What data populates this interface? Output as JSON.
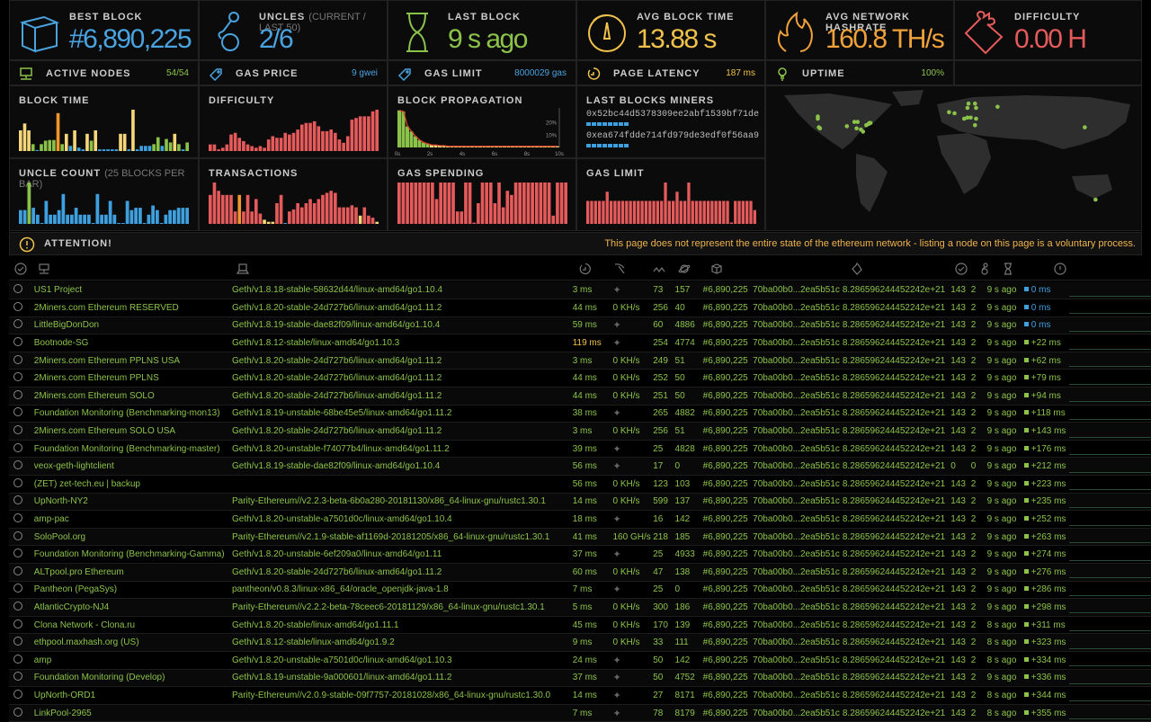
{
  "stats": {
    "best_block": {
      "label": "BEST BLOCK",
      "value": "#6,890,225",
      "color": "#4aa3df",
      "icon": "cube-icon"
    },
    "uncles": {
      "label": "UNCLES",
      "sublabel": "(CURRENT / LAST 50)",
      "value": "2/6",
      "color": "#4aa3df",
      "icon": "uncles-icon"
    },
    "last_block": {
      "label": "LAST BLOCK",
      "value": "9 s ago",
      "color": "#8bc34a",
      "icon": "hourglass-icon"
    },
    "avg_block_time": {
      "label": "AVG BLOCK TIME",
      "value": "13.88 s",
      "color": "#f0c24c",
      "icon": "gauge-icon"
    },
    "hashrate": {
      "label": "AVG NETWORK HASHRATE",
      "value": "160.8 TH/s",
      "color": "#f0a13a",
      "icon": "flame-icon"
    },
    "difficulty": {
      "label": "DIFFICULTY",
      "value": "0.00 H",
      "color": "#e55a5a",
      "icon": "puzzle-icon"
    }
  },
  "small_stats": {
    "active_nodes": {
      "label": "ACTIVE NODES",
      "value": "54/54",
      "color": "#8bc34a"
    },
    "gas_price": {
      "label": "GAS PRICE",
      "value": "9 gwei",
      "color": "#4aa3df"
    },
    "gas_limit": {
      "label": "GAS LIMIT",
      "value": "8000029 gas",
      "color": "#4aa3df"
    },
    "page_latency": {
      "label": "PAGE LATENCY",
      "value": "187 ms",
      "color": "#f0c24c"
    },
    "uptime": {
      "label": "UPTIME",
      "value": "100%",
      "color": "#8bc34a"
    }
  },
  "charts": {
    "block_time": {
      "title": "BLOCK TIME",
      "values": [
        6,
        8,
        6,
        2,
        0.3,
        2,
        3,
        3.2,
        3.2,
        11,
        2,
        5,
        1.5,
        6,
        1,
        0.5,
        5,
        3,
        6,
        0.5,
        0.5,
        0.5,
        0.5,
        0.5,
        5,
        5,
        0.5,
        12,
        0.5,
        1.5,
        1.5,
        1.5,
        2,
        4,
        1.5,
        3.5,
        2.5,
        5,
        2,
        0.5,
        2.5
      ],
      "colors": [
        "y",
        "y",
        "y",
        "g",
        "b",
        "g",
        "g",
        "g",
        "g",
        "o",
        "g",
        "y",
        "b",
        "y",
        "b",
        "b",
        "y",
        "g",
        "y",
        "b",
        "b",
        "b",
        "b",
        "b",
        "y",
        "y",
        "b",
        "y",
        "b",
        "b",
        "b",
        "b",
        "g",
        "g",
        "b",
        "g",
        "g",
        "y",
        "g",
        "b",
        "g"
      ]
    },
    "difficulty": {
      "title": "DIFFICULTY",
      "values": [
        4,
        4,
        1,
        2,
        4,
        10,
        11,
        8,
        6,
        4,
        3,
        2,
        3,
        2,
        7,
        9,
        8,
        8,
        11,
        10,
        11,
        13,
        16,
        17,
        17,
        18,
        15,
        12,
        12,
        13,
        11,
        7,
        5,
        9,
        19,
        20,
        21,
        21,
        21,
        24,
        25
      ]
    },
    "uncle_count": {
      "title": "UNCLE COUNT",
      "sublabel": "(25 BLOCKS PER BAR)",
      "values": [
        3,
        3,
        9,
        3.5,
        2,
        0,
        5,
        2,
        2,
        3,
        6.5,
        2,
        2,
        3.5,
        2,
        2,
        2,
        0,
        6.5,
        2,
        2,
        5,
        2,
        0,
        0,
        5,
        3,
        3.5,
        3.5,
        0,
        2,
        4,
        3,
        0,
        2,
        3,
        3,
        3.5,
        3.5,
        3.5
      ],
      "colors": [
        "b",
        "b",
        "g",
        "b",
        "b",
        "b",
        "b",
        "b",
        "b",
        "b",
        "b",
        "b",
        "b",
        "b",
        "b",
        "b",
        "b",
        "b",
        "b",
        "b",
        "b",
        "b",
        "b",
        "b",
        "b",
        "b",
        "b",
        "b",
        "b",
        "b",
        "b",
        "b",
        "b",
        "b",
        "b",
        "b",
        "b",
        "b",
        "b",
        "b"
      ]
    },
    "transactions": {
      "title": "TRANSACTIONS",
      "values": [
        7,
        10,
        8,
        7,
        7,
        7,
        3,
        7,
        3,
        7,
        3,
        6,
        2.5,
        1,
        0.5,
        0.5,
        5,
        7,
        0,
        3,
        3.5,
        5,
        4,
        5,
        6,
        5,
        6,
        7,
        7.5,
        8,
        7.5,
        4,
        4,
        4,
        4.5,
        4,
        2,
        4,
        2,
        1.5,
        0.5
      ],
      "colors": [
        "r",
        "r",
        "r",
        "r",
        "r",
        "r",
        "r",
        "o",
        "r",
        "r",
        "r",
        "r",
        "r",
        "y",
        "y",
        "y",
        "r",
        "r",
        "b",
        "r",
        "r",
        "r",
        "r",
        "r",
        "r",
        "r",
        "r",
        "r",
        "r",
        "r",
        "r",
        "r",
        "r",
        "r",
        "r",
        "r",
        "y",
        "r",
        "r",
        "r",
        "y"
      ]
    },
    "block_propagation": {
      "title": "BLOCK PROPAGATION",
      "xticks": [
        "0s",
        "2s",
        "4s",
        "6s",
        "8s",
        "10s"
      ],
      "yticks": [
        "20%",
        "10%"
      ],
      "values": [
        30,
        29,
        17,
        13,
        9,
        6,
        4,
        3,
        2,
        2,
        1.5,
        1.5,
        1,
        1,
        1,
        1,
        1,
        1,
        1,
        1,
        1,
        1,
        1,
        1,
        1,
        1,
        1,
        1,
        1,
        1,
        1,
        1,
        1,
        1,
        1,
        1,
        1,
        1,
        1,
        1
      ]
    },
    "last_blocks_miners": {
      "title": "LAST BLOCKS MINERS",
      "miners": [
        {
          "address": "0x52bc44d5378309ee2abf1539bf71de",
          "blocks": 8
        },
        {
          "address": "0xea674fdde714fd979de3edf0f56aa9",
          "blocks": 8
        }
      ]
    },
    "gas_spending": {
      "title": "GAS SPENDING",
      "values": [
        10,
        10,
        10,
        10,
        10,
        10,
        10,
        10,
        10,
        6,
        10,
        10,
        10,
        10,
        3,
        3,
        10,
        10,
        0.3,
        5,
        10,
        10,
        10,
        5,
        10,
        4,
        8,
        7,
        10,
        10,
        10,
        10,
        10,
        10,
        10,
        10,
        10,
        2,
        10,
        10,
        10
      ]
    },
    "gas_limit": {
      "title": "GAS LIMIT",
      "values": [
        5,
        5,
        5,
        5,
        5,
        7,
        5,
        5,
        5,
        5,
        5,
        5,
        5,
        5,
        5,
        5,
        5,
        5,
        5,
        5,
        9,
        5,
        5,
        7,
        5,
        5,
        9,
        5,
        5,
        5,
        5,
        5,
        5,
        5,
        5,
        5,
        5,
        0.3,
        5,
        5,
        5,
        5,
        5,
        3
      ]
    }
  },
  "attention": {
    "label": "ATTENTION!",
    "message": "This page does not represent the entire state of the ethereum network - listing a node on this page is a voluntary process."
  },
  "nodes": [
    {
      "name": "US1 Project",
      "type": "Geth/v1.8.18-stable-58632d44/linux-amd64/go1.10.4",
      "latency": "3 ms",
      "hashrate": "",
      "peers": "73",
      "pending": "157",
      "block": "#6,890,225",
      "hash": "70ba00b0...2ea5b51c",
      "difficulty": "8.286596244452242e+21",
      "txs": "143",
      "uncles": "2",
      "last": "9 s ago",
      "prop": "0 ms",
      "prop_color": "b"
    },
    {
      "name": "2Miners.com Ethereum RESERVED",
      "type": "Geth/v1.8.20-stable-24d727b6/linux-amd64/go1.11.2",
      "latency": "44 ms",
      "hashrate": "0 KH/s",
      "peers": "256",
      "pending": "40",
      "block": "#6,890,225",
      "hash": "70ba00b0...2ea5b51c",
      "difficulty": "8.286596244452242e+21",
      "txs": "143",
      "uncles": "2",
      "last": "9 s ago",
      "prop": "0 ms",
      "prop_color": "b"
    },
    {
      "name": "LittleBigDonDon",
      "type": "Geth/v1.8.19-stable-dae82f09/linux-amd64/go1.10.4",
      "latency": "59 ms",
      "hashrate": "",
      "peers": "60",
      "pending": "4886",
      "block": "#6,890,225",
      "hash": "70ba00b0...2ea5b51c",
      "difficulty": "8.286596244452242e+21",
      "txs": "143",
      "uncles": "2",
      "last": "9 s ago",
      "prop": "0 ms",
      "prop_color": "b"
    },
    {
      "name": "Bootnode-SG",
      "type": "Geth/v1.8.12-stable/linux-amd64/go1.10.3",
      "latency": "119 ms",
      "latency_warn": true,
      "hashrate": "",
      "peers": "254",
      "pending": "4774",
      "block": "#6,890,225",
      "hash": "70ba00b0...2ea5b51c",
      "difficulty": "8.286596244452242e+21",
      "txs": "143",
      "uncles": "2",
      "last": "9 s ago",
      "prop": "+22 ms",
      "prop_color": "g"
    },
    {
      "name": "2Miners.com Ethereum PPLNS USA",
      "type": "Geth/v1.8.20-stable-24d727b6/linux-amd64/go1.11.2",
      "latency": "3 ms",
      "hashrate": "0 KH/s",
      "peers": "249",
      "pending": "51",
      "block": "#6,890,225",
      "hash": "70ba00b0...2ea5b51c",
      "difficulty": "8.286596244452242e+21",
      "txs": "143",
      "uncles": "2",
      "last": "9 s ago",
      "prop": "+62 ms",
      "prop_color": "g"
    },
    {
      "name": "2Miners.com Ethereum PPLNS",
      "type": "Geth/v1.8.20-stable-24d727b6/linux-amd64/go1.11.2",
      "latency": "44 ms",
      "hashrate": "0 KH/s",
      "peers": "252",
      "pending": "50",
      "block": "#6,890,225",
      "hash": "70ba00b0...2ea5b51c",
      "difficulty": "8.286596244452242e+21",
      "txs": "143",
      "uncles": "2",
      "last": "9 s ago",
      "prop": "+79 ms",
      "prop_color": "g"
    },
    {
      "name": "2Miners.com Ethereum SOLO",
      "type": "Geth/v1.8.20-stable-24d727b6/linux-amd64/go1.11.2",
      "latency": "44 ms",
      "hashrate": "0 KH/s",
      "peers": "251",
      "pending": "50",
      "block": "#6,890,225",
      "hash": "70ba00b0...2ea5b51c",
      "difficulty": "8.286596244452242e+21",
      "txs": "143",
      "uncles": "2",
      "last": "9 s ago",
      "prop": "+94 ms",
      "prop_color": "g"
    },
    {
      "name": "Foundation Monitoring (Benchmarking-mon13)",
      "type": "Geth/v1.8.19-unstable-68be45e5/linux-amd64/go1.11.2",
      "latency": "38 ms",
      "hashrate": "",
      "peers": "265",
      "pending": "4882",
      "block": "#6,890,225",
      "hash": "70ba00b0...2ea5b51c",
      "difficulty": "8.286596244452242e+21",
      "txs": "143",
      "uncles": "2",
      "last": "9 s ago",
      "prop": "+118 ms",
      "prop_color": "g"
    },
    {
      "name": "2Miners.com Ethereum SOLO USA",
      "type": "Geth/v1.8.20-stable-24d727b6/linux-amd64/go1.11.2",
      "latency": "3 ms",
      "hashrate": "0 KH/s",
      "peers": "256",
      "pending": "51",
      "block": "#6,890,225",
      "hash": "70ba00b0...2ea5b51c",
      "difficulty": "8.286596244452242e+21",
      "txs": "143",
      "uncles": "2",
      "last": "9 s ago",
      "prop": "+143 ms",
      "prop_color": "g"
    },
    {
      "name": "Foundation Monitoring (Benchmarking-master)",
      "type": "Geth/v1.8.20-unstable-f74077b4/linux-amd64/go1.11.2",
      "latency": "39 ms",
      "hashrate": "",
      "peers": "25",
      "pending": "4828",
      "block": "#6,890,225",
      "hash": "70ba00b0...2ea5b51c",
      "difficulty": "8.286596244452242e+21",
      "txs": "143",
      "uncles": "2",
      "last": "9 s ago",
      "prop": "+176 ms",
      "prop_color": "g"
    },
    {
      "name": "veox-geth-lightclient",
      "type": "Geth/v1.8.19-stable-dae82f09/linux-amd64/go1.10.4",
      "latency": "56 ms",
      "hashrate": "",
      "peers": "17",
      "pending": "0",
      "block": "#6,890,225",
      "hash": "70ba00b0...2ea5b51c",
      "difficulty": "8.286596244452242e+21",
      "txs": "0",
      "uncles": "0",
      "last": "9 s ago",
      "prop": "+212 ms",
      "prop_color": "g"
    },
    {
      "name": "(ZET) zet-tech.eu | backup",
      "type": "",
      "latency": "56 ms",
      "hashrate": "0 KH/s",
      "peers": "123",
      "pending": "103",
      "block": "#6,890,225",
      "hash": "70ba00b0...2ea5b51c",
      "difficulty": "8.286596244452242e+21",
      "txs": "143",
      "uncles": "2",
      "last": "9 s ago",
      "prop": "+223 ms",
      "prop_color": "g"
    },
    {
      "name": "UpNorth-NY2",
      "type": "Parity-Ethereum//v2.2.3-beta-6b0a280-20181130/x86_64-linux-gnu/rustc1.30.1",
      "latency": "14 ms",
      "hashrate": "0 KH/s",
      "peers": "599",
      "pending": "137",
      "block": "#6,890,225",
      "hash": "70ba00b0...2ea5b51c",
      "difficulty": "8.286596244452242e+21",
      "txs": "143",
      "uncles": "2",
      "last": "9 s ago",
      "prop": "+235 ms",
      "prop_color": "g"
    },
    {
      "name": "amp-pac",
      "type": "Geth/v1.8.20-unstable-a7501d0c/linux-amd64/go1.10.4",
      "latency": "18 ms",
      "hashrate": "",
      "peers": "16",
      "pending": "142",
      "block": "#6,890,225",
      "hash": "70ba00b0...2ea5b51c",
      "difficulty": "8.286596244452242e+21",
      "txs": "143",
      "uncles": "2",
      "last": "9 s ago",
      "prop": "+252 ms",
      "prop_color": "g"
    },
    {
      "name": "SoloPool.org",
      "type": "Parity-Ethereum//v2.1.9-stable-af1169d-20181205/x86_64-linux-gnu/rustc1.30.1",
      "latency": "41 ms",
      "hashrate": "160 GH/s",
      "peers": "218",
      "pending": "185",
      "block": "#6,890,225",
      "hash": "70ba00b0...2ea5b51c",
      "difficulty": "8.286596244452242e+21",
      "txs": "143",
      "uncles": "2",
      "last": "9 s ago",
      "prop": "+263 ms",
      "prop_color": "g"
    },
    {
      "name": "Foundation Monitoring (Benchmarking-Gamma)",
      "type": "Geth/v1.8.20-unstable-6ef209a0/linux-amd64/go1.11",
      "latency": "37 ms",
      "hashrate": "",
      "peers": "25",
      "pending": "4933",
      "block": "#6,890,225",
      "hash": "70ba00b0...2ea5b51c",
      "difficulty": "8.286596244452242e+21",
      "txs": "143",
      "uncles": "2",
      "last": "9 s ago",
      "prop": "+274 ms",
      "prop_color": "g"
    },
    {
      "name": "ALTpool.pro Ethereum",
      "type": "Geth/v1.8.20-stable-24d727b6/linux-amd64/go1.11.2",
      "latency": "60 ms",
      "hashrate": "0 KH/s",
      "peers": "47",
      "pending": "138",
      "block": "#6,890,225",
      "hash": "70ba00b0...2ea5b51c",
      "difficulty": "8.286596244452242e+21",
      "txs": "143",
      "uncles": "2",
      "last": "9 s ago",
      "prop": "+276 ms",
      "prop_color": "g"
    },
    {
      "name": "Pantheon (PegaSys)",
      "type": "pantheon/v0.8.3/linux-x86_64/oracle_openjdk-java-1.8",
      "latency": "7 ms",
      "hashrate": "",
      "peers": "25",
      "pending": "0",
      "block": "#6,890,225",
      "hash": "70ba00b0...2ea5b51c",
      "difficulty": "8.286596244452242e+21",
      "txs": "143",
      "uncles": "2",
      "last": "9 s ago",
      "prop": "+286 ms",
      "prop_color": "g"
    },
    {
      "name": "AtlanticCrypto-NJ4",
      "type": "Parity-Ethereum//v2.2.2-beta-78ceec6-20181129/x86_64-linux-gnu/rustc1.30.1",
      "latency": "5 ms",
      "hashrate": "0 KH/s",
      "peers": "300",
      "pending": "186",
      "block": "#6,890,225",
      "hash": "70ba00b0...2ea5b51c",
      "difficulty": "8.286596244452242e+21",
      "txs": "143",
      "uncles": "2",
      "last": "9 s ago",
      "prop": "+298 ms",
      "prop_color": "g"
    },
    {
      "name": "Clona Network - Clona.ru",
      "type": "Geth/v1.8.20-stable/linux-amd64/go1.11.1",
      "latency": "45 ms",
      "hashrate": "0 KH/s",
      "peers": "170",
      "pending": "139",
      "block": "#6,890,225",
      "hash": "70ba00b0...2ea5b51c",
      "difficulty": "8.286596244452242e+21",
      "txs": "143",
      "uncles": "2",
      "last": "8 s ago",
      "prop": "+311 ms",
      "prop_color": "g"
    },
    {
      "name": "ethpool.maxhash.org (US)",
      "type": "Geth/v1.8.12-stable/linux-amd64/go1.9.2",
      "latency": "9 ms",
      "hashrate": "0 KH/s",
      "peers": "33",
      "pending": "111",
      "block": "#6,890,225",
      "hash": "70ba00b0...2ea5b51c",
      "difficulty": "8.286596244452242e+21",
      "txs": "143",
      "uncles": "2",
      "last": "8 s ago",
      "prop": "+323 ms",
      "prop_color": "g"
    },
    {
      "name": "amp",
      "type": "Geth/v1.8.20-unstable-a7501d0c/linux-amd64/go1.10.3",
      "latency": "24 ms",
      "hashrate": "",
      "peers": "50",
      "pending": "142",
      "block": "#6,890,225",
      "hash": "70ba00b0...2ea5b51c",
      "difficulty": "8.286596244452242e+21",
      "txs": "143",
      "uncles": "2",
      "last": "8 s ago",
      "prop": "+334 ms",
      "prop_color": "g"
    },
    {
      "name": "Foundation Monitoring (Develop)",
      "type": "Geth/v1.8.19-unstable-9a000601/linux-amd64/go1.11.2",
      "latency": "37 ms",
      "hashrate": "",
      "peers": "50",
      "pending": "4752",
      "block": "#6,890,225",
      "hash": "70ba00b0...2ea5b51c",
      "difficulty": "8.286596244452242e+21",
      "txs": "143",
      "uncles": "2",
      "last": "9 s ago",
      "prop": "+336 ms",
      "prop_color": "g"
    },
    {
      "name": "UpNorth-ORD1",
      "type": "Parity-Ethereum//v2.0.9-stable-09f7757-20181028/x86_64-linux-gnu/rustc1.30.0",
      "latency": "14 ms",
      "hashrate": "",
      "peers": "27",
      "pending": "8171",
      "block": "#6,890,225",
      "hash": "70ba00b0...2ea5b51c",
      "difficulty": "8.286596244452242e+21",
      "txs": "143",
      "uncles": "2",
      "last": "8 s ago",
      "prop": "+344 ms",
      "prop_color": "g"
    },
    {
      "name": "LinkPool-2965",
      "type": "",
      "latency": "7 ms",
      "hashrate": "",
      "peers": "78",
      "pending": "8179",
      "block": "#6,890,225",
      "hash": "70ba00b0...2ea5b51c",
      "difficulty": "8.286596244452242e+21",
      "txs": "143",
      "uncles": "2",
      "last": "8 s ago",
      "prop": "+355 ms",
      "prop_color": "g"
    }
  ],
  "map": {
    "markers": [
      [
        -122,
        47
      ],
      [
        -122,
        45
      ],
      [
        -121,
        37
      ],
      [
        -120,
        36
      ],
      [
        -95,
        38
      ],
      [
        -88,
        42
      ],
      [
        -85,
        42
      ],
      [
        -86,
        36
      ],
      [
        -82,
        35
      ],
      [
        -80,
        33
      ],
      [
        -77,
        39
      ],
      [
        -75,
        40
      ],
      [
        -74,
        41
      ],
      [
        -73,
        41
      ],
      [
        -0.1,
        51
      ],
      [
        5,
        50
      ],
      [
        18,
        59
      ],
      [
        24,
        59
      ],
      [
        17,
        55
      ],
      [
        25,
        55
      ],
      [
        17,
        46
      ],
      [
        20,
        46
      ],
      [
        14,
        45
      ],
      [
        25,
        45
      ],
      [
        24,
        39
      ],
      [
        45,
        56
      ],
      [
        126,
        37
      ],
      [
        136,
        -30
      ]
    ]
  }
}
